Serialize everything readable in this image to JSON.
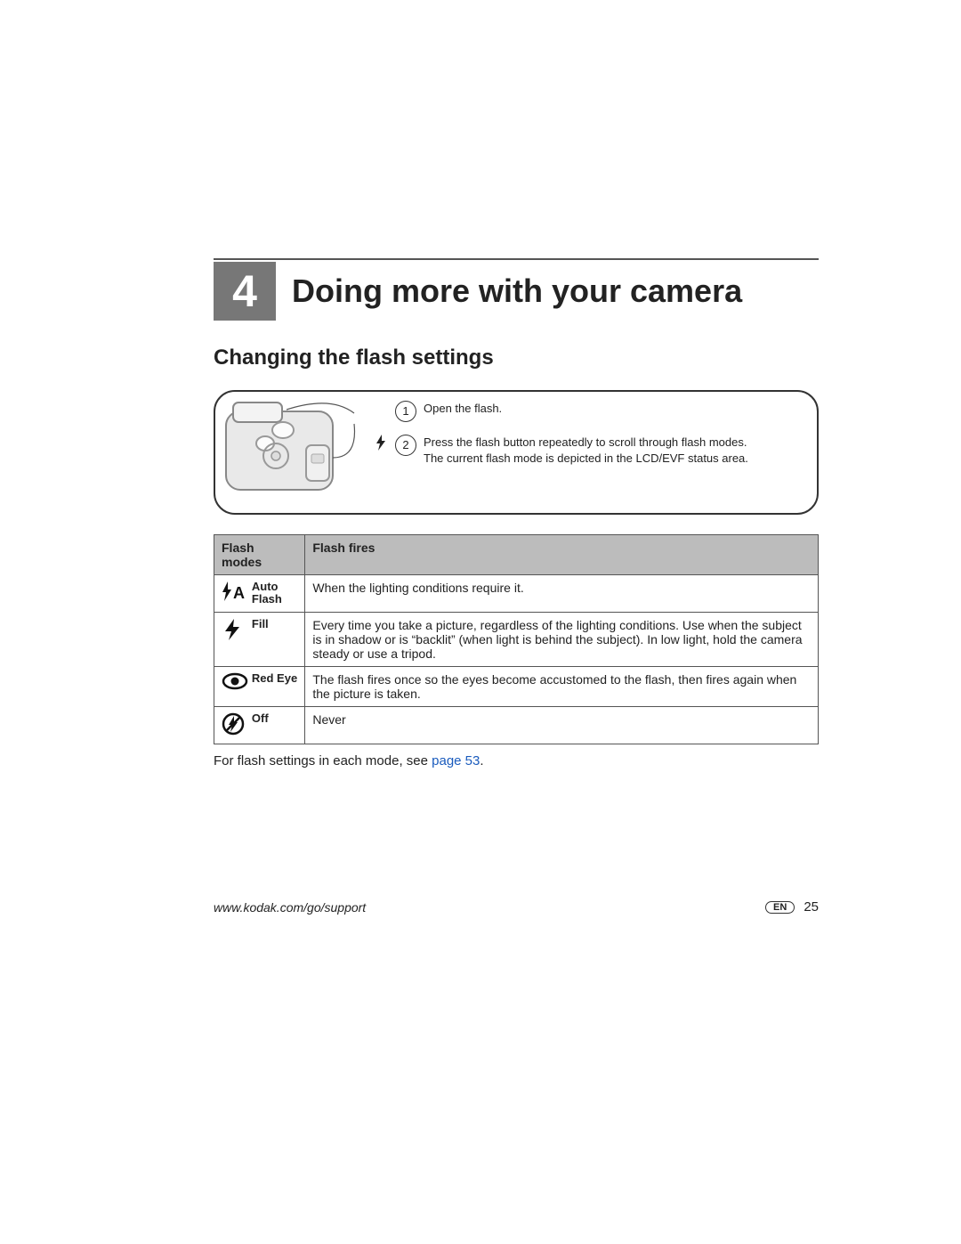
{
  "chapter": {
    "number": "4",
    "title": "Doing more with your camera"
  },
  "section": {
    "title": "Changing the flash settings"
  },
  "callout": {
    "step1": {
      "num": "1",
      "text": "Open the flash."
    },
    "step2": {
      "num": "2",
      "line1": "Press the flash button repeatedly to scroll through flash modes.",
      "line2": "The current flash mode is depicted in the LCD/EVF status area."
    }
  },
  "table": {
    "head": {
      "col1": "Flash modes",
      "col2": "Flash fires"
    },
    "rows": {
      "auto": {
        "label": "Auto Flash",
        "label_line1": "Auto",
        "label_line2": "Flash",
        "fires": "When the lighting conditions require it."
      },
      "fill": {
        "label": "Fill",
        "fires": "Every time you take a picture, regardless of the lighting conditions. Use when the subject is in shadow or is “backlit” (when light is behind the subject). In low light, hold the camera steady or use a tripod."
      },
      "redeye": {
        "label": "Red Eye",
        "fires": "The flash fires once so the eyes become accustomed to the flash, then fires again when the picture is taken."
      },
      "off": {
        "label": "Off",
        "fires": "Never"
      }
    }
  },
  "note": {
    "prefix": "For flash settings in each mode, see ",
    "link": "page 53",
    "suffix": "."
  },
  "footer": {
    "url": "www.kodak.com/go/support",
    "lang": "EN",
    "page": "25"
  }
}
